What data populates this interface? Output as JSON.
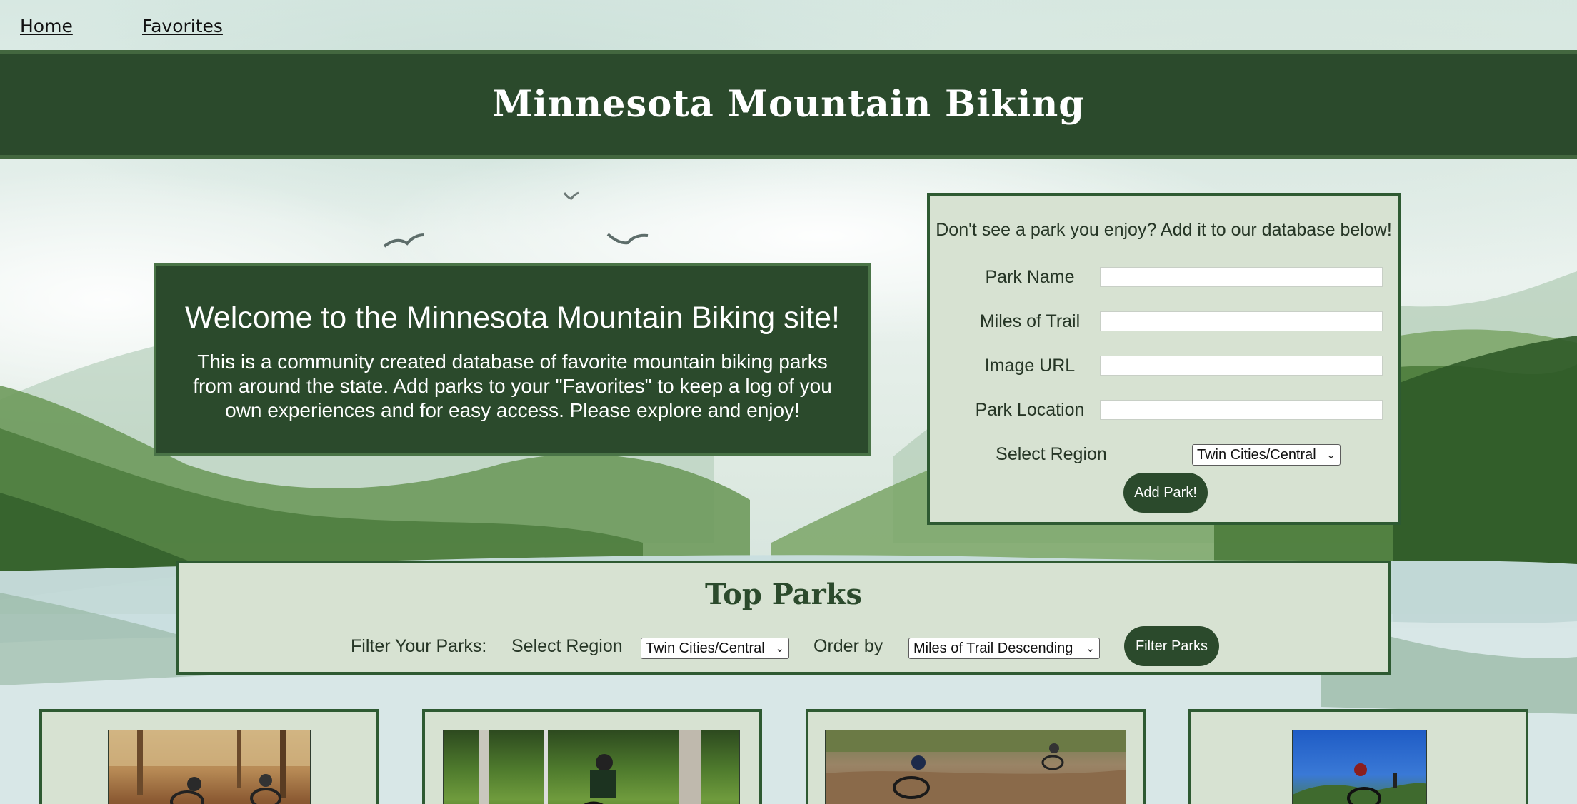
{
  "nav": {
    "home_label": "Home",
    "favorites_label": "Favorites"
  },
  "banner": {
    "title": "Minnesota Mountain Biking"
  },
  "welcome": {
    "heading": "Welcome to the Minnesota Mountain Biking site!",
    "body": "This is a community created database of favorite mountain biking parks from around the state. Add parks to your \"Favorites\" to keep a log of you own experiences and for easy access. Please explore and enjoy!"
  },
  "add_park_form": {
    "intro": "Don't see a park you enjoy? Add it to our database below!",
    "park_name_label": "Park Name",
    "park_name_value": "",
    "miles_label": "Miles of Trail",
    "miles_value": "",
    "image_url_label": "Image URL",
    "image_url_value": "",
    "location_label": "Park Location",
    "location_value": "",
    "region_label": "Select Region",
    "region_selected": "Twin Cities/Central",
    "submit_label": "Add Park!"
  },
  "top_parks": {
    "heading": "Top Parks",
    "filter_label": "Filter Your Parks:",
    "region_label": "Select Region",
    "region_selected": "Twin Cities/Central",
    "order_label": "Order by",
    "order_selected": "Miles of Trail Descending",
    "filter_button": "Filter Parks"
  },
  "park_cards": [
    {
      "photo": "mountain-bikers-on-dirt-trail-in-autumn-woods"
    },
    {
      "photo": "mountain-biker-riding-through-green-forest"
    },
    {
      "photo": "mountain-bikers-cornering-on-dirt-berm"
    },
    {
      "photo": "mountain-biker-on-rocks-under-blue-sky"
    }
  ],
  "colors": {
    "dark_green": "#2b4a2c",
    "panel_green": "#d7e2d2",
    "border_green": "#2e5a32"
  }
}
